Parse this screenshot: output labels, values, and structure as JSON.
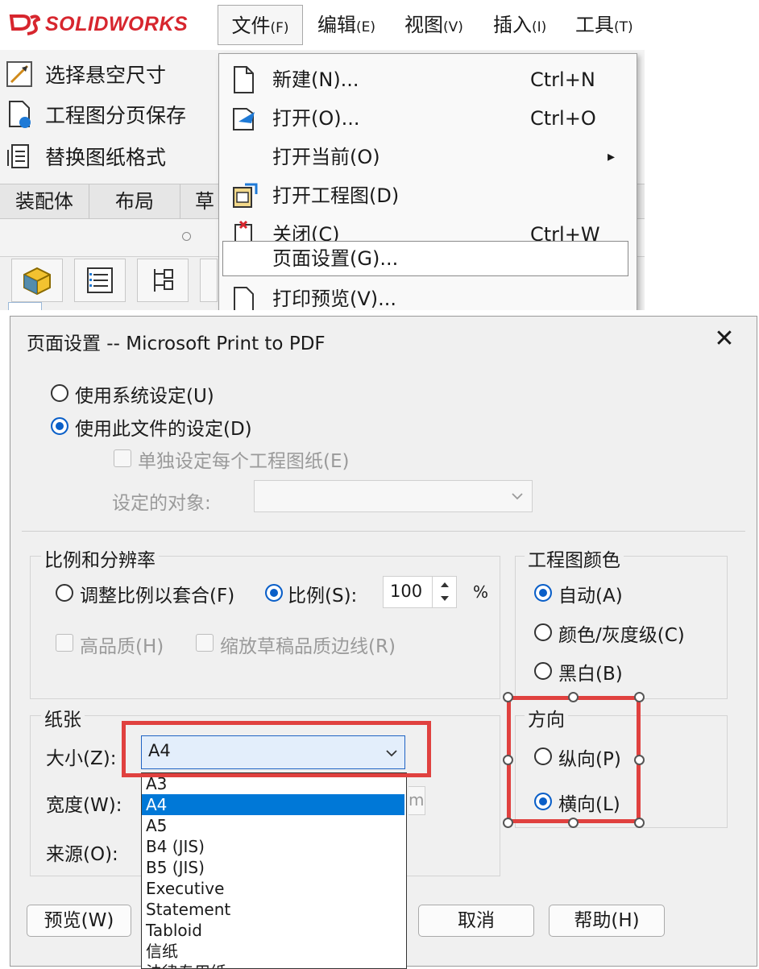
{
  "app": {
    "logo_text": "SOLIDWORKS",
    "brand_color": "#d7262e"
  },
  "menubar": {
    "items": [
      {
        "label": "文件",
        "accel": "(F)"
      },
      {
        "label": "编辑",
        "accel": "(E)"
      },
      {
        "label": "视图",
        "accel": "(V)"
      },
      {
        "label": "插入",
        "accel": "(I)"
      },
      {
        "label": "工具",
        "accel": "(T)"
      }
    ]
  },
  "commands": [
    {
      "label": "选择悬空尺寸",
      "icon": "dimension-icon"
    },
    {
      "label": "工程图分页保存",
      "icon": "document-save-icon"
    },
    {
      "label": "替换图纸格式",
      "icon": "sheet-format-icon"
    }
  ],
  "tabs": [
    "装配体",
    "布局",
    "草"
  ],
  "file_menu": {
    "items": [
      {
        "label": "新建(N)...",
        "shortcut": "Ctrl+N",
        "icon": "new-document-icon"
      },
      {
        "label": "打开(O)...",
        "shortcut": "Ctrl+O",
        "icon": "open-folder-icon"
      },
      {
        "label": "打开当前(O)",
        "shortcut": "",
        "submenu": "▸"
      },
      {
        "label": "打开工程图(D)",
        "shortcut": "",
        "icon": "open-drawing-icon"
      },
      {
        "label": "关闭(C)",
        "shortcut": "Ctrl+W",
        "icon": "close-document-icon"
      },
      {
        "label": "页面设置(G)...",
        "shortcut": ""
      },
      {
        "label": "打印预览(V)...",
        "shortcut": "",
        "icon": "print-preview-icon"
      }
    ]
  },
  "dialog": {
    "title": "页面设置 -- Microsoft Print to PDF",
    "close_glyph": "✕",
    "use_system": "使用系统设定(U)",
    "use_file": "使用此文件的设定(D)",
    "separate_each": "单独设定每个工程图纸(E)",
    "target_label": "设定的对象:",
    "scale_group": {
      "title": "比例和分辨率",
      "fit": "调整比例以套合(F)",
      "scale": "比例(S):",
      "scale_value": "100",
      "percent": "%",
      "high_quality": "高品质(H)",
      "scale_draft": "缩放草稿品质边线(R)"
    },
    "color_group": {
      "title": "工程图颜色",
      "auto": "自动(A)",
      "color_gray": "颜色/灰度级(C)",
      "bw": "黑白(B)"
    },
    "paper_group": {
      "title": "纸张",
      "size_label": "大小(Z):",
      "size_value": "A4",
      "width_label": "宽度(W):",
      "source_label": "来源(O):",
      "width_unit_fragment": "m",
      "options": [
        "A3",
        "A4",
        "A5",
        "B4 (JIS)",
        "B5 (JIS)",
        "Executive",
        "Statement",
        "Tabloid",
        "信纸",
        "法律专用纸"
      ],
      "selected_index": 1
    },
    "orientation_group": {
      "title": "方向",
      "portrait": "纵向(P)",
      "landscape": "横向(L)"
    },
    "buttons": {
      "preview": "预览(W)",
      "cancel": "取消",
      "help": "帮助(H)"
    }
  },
  "annotation_color": "#e0413f"
}
